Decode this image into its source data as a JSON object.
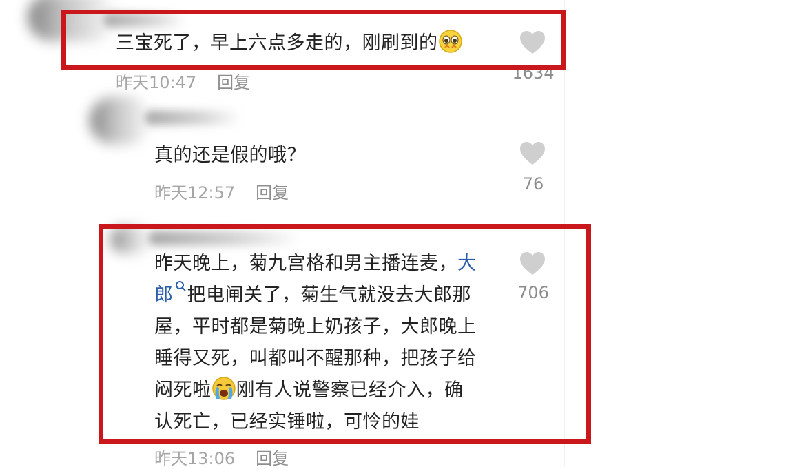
{
  "comments": [
    {
      "text": "三宝死了，早上六点多走的，刚刷到的",
      "emoji": "pleading-face-emoji",
      "time": "昨天10:47",
      "reply_label": "回复",
      "likes": "1634",
      "highlighted": true
    },
    {
      "text": "真的还是假的哦？",
      "time": "昨天12:57",
      "reply_label": "回复",
      "likes": "76",
      "highlighted": false
    },
    {
      "lines": [
        "昨天晚上，菊九宫格和男主播连麦，",
        "把电闸关了，菊生气就没去大郎那",
        "屋，平时都是菊晚上奶孩子，大郎晚上",
        "睡得又死，叫都叫不醒那种，把孩子给",
        "闷死啦",
        "刚有人说警察已经介入，确",
        "认死亡，已经实锤啦，可怜的娃"
      ],
      "link_text_1": "大",
      "link_text_2": "郎",
      "emoji": "crying-face-emoji",
      "time": "昨天13:06",
      "reply_label": "回复",
      "likes": "706",
      "highlighted": true
    }
  ],
  "colors": {
    "highlight_border": "#c9171c",
    "link": "#2a5ea8",
    "meta_text": "#a5a5a5",
    "heart": "#cfcfcf"
  },
  "icons": [
    "heart-icon",
    "search-icon",
    "pleading-face-emoji",
    "crying-face-emoji"
  ]
}
